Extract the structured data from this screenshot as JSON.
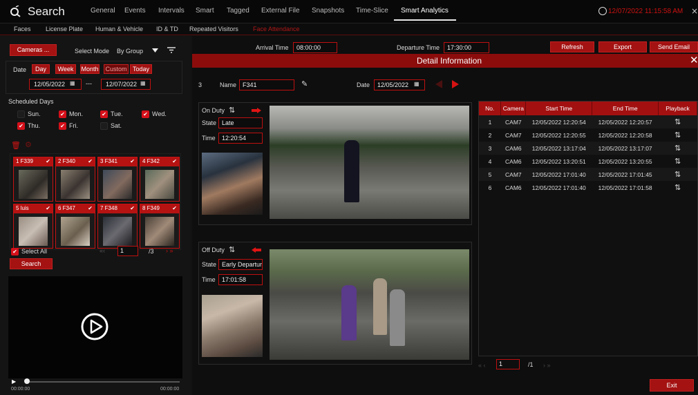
{
  "app": {
    "title": "Search"
  },
  "topnav": {
    "items": [
      "General",
      "Events",
      "Intervals",
      "Smart",
      "Tagged",
      "External File",
      "Snapshots",
      "Time-Slice",
      "Smart Analytics"
    ],
    "active": "Smart Analytics",
    "clock": "12/07/2022 11:15:58 AM"
  },
  "subtabs": {
    "items": [
      "Faces",
      "License Plate",
      "Human & Vehicle",
      "ID & TD",
      "Repeated Visitors",
      "Face Attendance"
    ],
    "active": "Face Attendance"
  },
  "left": {
    "cameras_button": "Cameras ...",
    "select_mode_label": "Select Mode",
    "select_mode_value": "By Group",
    "date_label": "Date",
    "date_tabs": [
      "Day",
      "Week",
      "Month",
      "Custom",
      "Today"
    ],
    "start_date": "12/05/2022",
    "separator": "---",
    "end_date": "12/07/2022",
    "scheduled_label": "Scheduled Days",
    "days": [
      {
        "label": "Sun.",
        "checked": false
      },
      {
        "label": "Mon.",
        "checked": true
      },
      {
        "label": "Tue.",
        "checked": true
      },
      {
        "label": "Wed.",
        "checked": true
      },
      {
        "label": "Thu.",
        "checked": true
      },
      {
        "label": "Fri.",
        "checked": true
      },
      {
        "label": "Sat.",
        "checked": false
      }
    ],
    "faces": [
      "1 F339",
      "2 F340",
      "3 F341",
      "4 F342",
      "5 luis",
      "6 F347",
      "7 F348",
      "8 F349"
    ],
    "select_all": "Select All",
    "page_value": "1",
    "page_total": "/3",
    "search_button": "Search",
    "time_start": "00:00:00",
    "time_end": "00:00:00"
  },
  "toolbar": {
    "arrival_label": "Arrival Time",
    "arrival_value": "08:00:00",
    "departure_label": "Departure Time",
    "departure_value": "17:30:00",
    "refresh": "Refresh",
    "export": "Export",
    "send_email": "Send Email"
  },
  "detail": {
    "title": "Detail Information",
    "index": "3",
    "name_label": "Name",
    "name_value": "F341",
    "date_label": "Date",
    "date_value": "12/05/2022",
    "on_duty": {
      "label": "On Duty",
      "state_label": "State",
      "state_value": "Late",
      "time_label": "Time",
      "time_value": "12:20:54"
    },
    "off_duty": {
      "label": "Off Duty",
      "state_label": "State",
      "state_value": "Early Departure",
      "time_label": "Time",
      "time_value": "17:01:58"
    },
    "table": {
      "headers": [
        "No.",
        "Camera",
        "Start Time",
        "End Time",
        "Playback"
      ],
      "rows": [
        [
          "1",
          "CAM7",
          "12/05/2022 12:20:54",
          "12/05/2022 12:20:57"
        ],
        [
          "2",
          "CAM7",
          "12/05/2022 12:20:55",
          "12/05/2022 12:20:58"
        ],
        [
          "3",
          "CAM6",
          "12/05/2022 13:17:04",
          "12/05/2022 13:17:07"
        ],
        [
          "4",
          "CAM6",
          "12/05/2022 13:20:51",
          "12/05/2022 13:20:55"
        ],
        [
          "5",
          "CAM7",
          "12/05/2022 17:01:40",
          "12/05/2022 17:01:45"
        ],
        [
          "6",
          "CAM6",
          "12/05/2022 17:01:40",
          "12/05/2022 17:01:58"
        ]
      ]
    },
    "page_value": "1",
    "page_total": "/1",
    "exit": "Exit"
  },
  "colors": {
    "accent": "#a41212",
    "clock": "#cc1111"
  }
}
